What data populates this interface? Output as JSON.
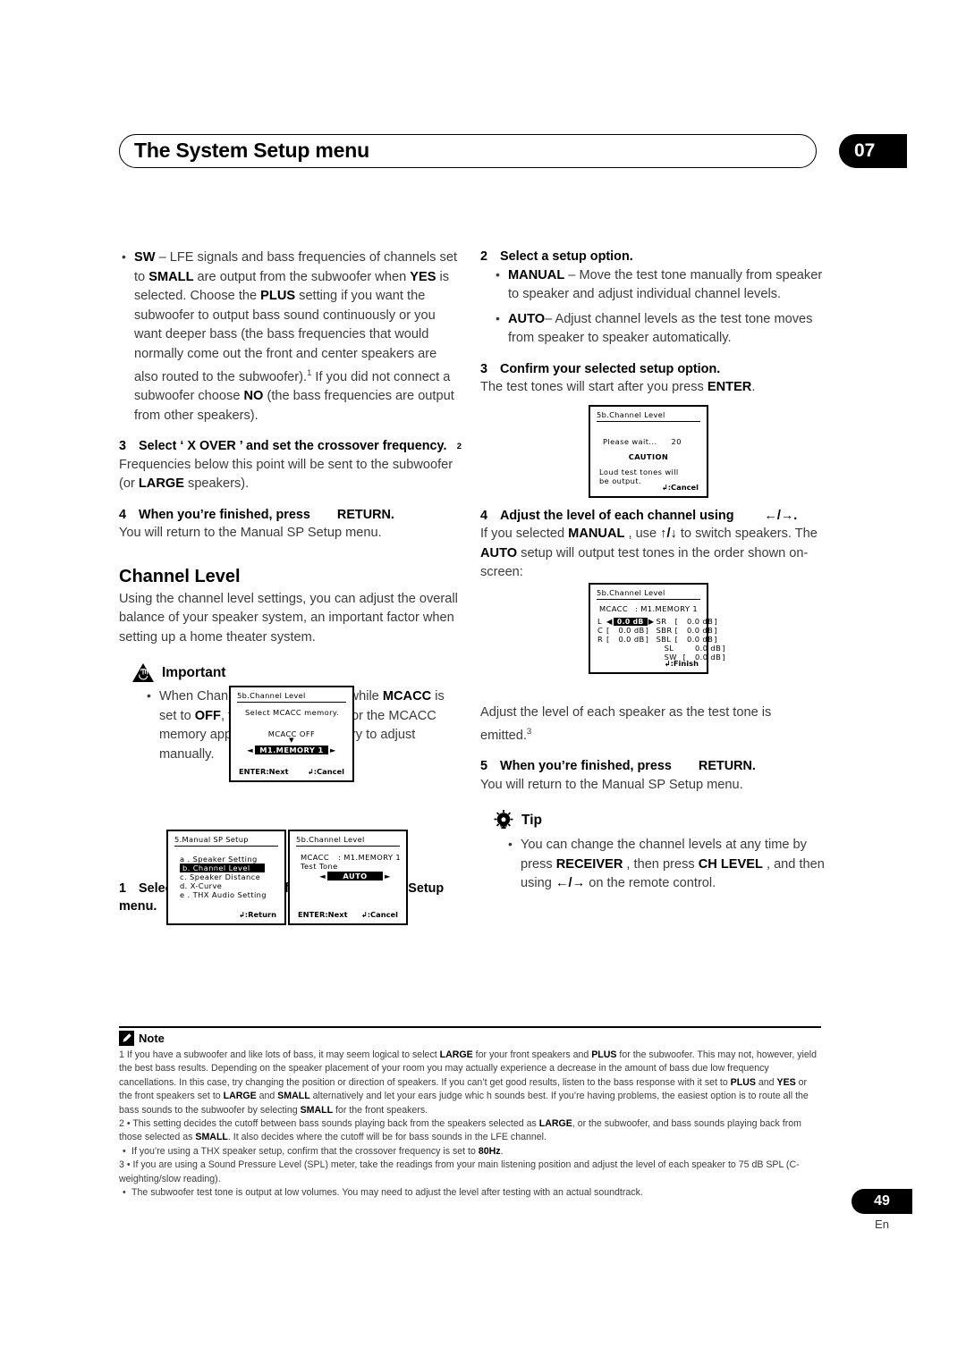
{
  "header": {
    "title": "The System Setup menu",
    "chapter": "07"
  },
  "left_column": {
    "sw_bullet": {
      "label": "SW",
      "text_1": " – LFE signals and bass frequencies of channels set to ",
      "small": "SMALL",
      "text_2": " are output from the subwoofer when ",
      "yes": "YES",
      "text_3": " is selected. Choose the ",
      "plus": "PLUS",
      "text_4": " setting if you want the subwoofer to output bass sound continuously or you want deeper bass (the bass frequencies that would normally come out the front and center speakers are also routed to the subwoofer).",
      "footnote_ref": "1",
      "text_5": " If you did not connect a subwoofer choose ",
      "no": "NO",
      "text_6": " (the bass frequencies are output from other speakers)."
    },
    "step3": {
      "num": "3",
      "title": "Select ‘ X OVER  ’ and set the crossover frequency.",
      "footnote_ref": "2",
      "body_1": "Frequencies below this point will be sent to the subwoofer (or ",
      "large": "LARGE",
      "body_2": " speakers)."
    },
    "step4": {
      "num": "4",
      "title": "When you’re finished, press",
      "title_key": "RETURN",
      "title_end": ".",
      "body": "You will return to the Manual SP Setup menu."
    },
    "section_heading": "Channel Level",
    "section_body": "Using the channel level settings, you can adjust the overall balance of your speaker system, an important factor when setting up a home theater system.",
    "important": {
      "heading": "Important",
      "text_1": "When Channel Level is selected while ",
      "mcacc": "MCACC",
      "text_2": " is set to ",
      "off": "OFF",
      "text_3": ", the selection screen for the MCACC memory appears. Select a memory to adjust manually."
    },
    "step1": {
      "num": "1",
      "title": "Select ‘ Channel Level  ’ from the Manual SP Setup menu."
    }
  },
  "right_column": {
    "step2": {
      "num": "2",
      "title": "Select a setup option.",
      "manual_label": "MANUAL",
      "manual_text": " – Move the test tone manually from speaker to speaker and adjust individual channel levels.",
      "auto_label": "AUTO",
      "auto_text": "– Adjust channel levels as the test tone moves from speaker to speaker automatically."
    },
    "step3": {
      "num": "3",
      "title": "Confirm your selected setup option.",
      "body_1": "The test tones will start after you press ",
      "enter": "ENTER",
      "body_2": "."
    },
    "step4": {
      "num": "4",
      "title": "Adjust the level of each channel using",
      "title_keys": "←/→.",
      "body_1": "If you selected ",
      "manual": "MANUAL",
      "body_2": " , use ",
      "updown": "↑/↓",
      "body_3": " to switch speakers. The ",
      "auto": "AUTO",
      "body_4": " setup will output test tones in the order shown on-screen:"
    },
    "after_levels_1": "Adjust the level of each speaker as the test tone is emitted.",
    "after_levels_ref": "3",
    "step5": {
      "num": "5",
      "title": "When you’re finished, press",
      "title_key": "RETURN",
      "title_end": ".",
      "body": "You will return to the Manual SP Setup menu."
    },
    "tip": {
      "heading": "Tip",
      "text_1": "You can change the channel levels at any time by press ",
      "receiver": "RECEIVER",
      "text_2": " , then press ",
      "chlevel": "CH LEVEL",
      "text_3": " , and then using ",
      "arrows": "←/→",
      "text_4": " on the remote control."
    }
  },
  "osd_screens": {
    "mcacc_memory": {
      "title": "5b.Channel  Level",
      "prompt": "Select  MCACC  memory.",
      "label": "MCACC  OFF",
      "selected": "M1.MEMORY  1",
      "left_arrow": "◄",
      "right_arrow": "►",
      "down_marker": "▼",
      "foot_left": "ENTER:Next",
      "foot_right": ":Cancel"
    },
    "manual_sp_setup": {
      "title": "5.Manual  SP  Setup",
      "items": [
        "a . Speaker  Setting",
        "b. Channel  Level",
        "c. Speaker  Distance",
        "d. X-Curve",
        "e . THX  Audio  Setting"
      ],
      "selected_index": 1,
      "foot_right": ":Return"
    },
    "test_tone": {
      "title": "5b.Channel  Level",
      "row1_label": "MCACC",
      "row1_value": ": M1.MEMORY  1",
      "row2_label": "Test  Tone",
      "selected": "AUTO",
      "left_arrow": "◄",
      "right_arrow": "►",
      "foot_left": "ENTER:Next",
      "foot_right": ":Cancel"
    },
    "please_wait": {
      "title": "5b.Channel  Level",
      "wait_text": "Please  wait...",
      "wait_count": "20",
      "caution": "CAUTION",
      "message_1": "Loud  test  tones  will",
      "message_2": "be  output.",
      "foot_right": ":Cancel"
    },
    "channel_levels": {
      "title": "5b.Channel  Level",
      "mcacc_label": "MCACC",
      "mcacc_value": ": M1.MEMORY  1",
      "left_rows": [
        {
          "ch": "L",
          "value": "0.0 dB",
          "highlighted": true
        },
        {
          "ch": "C",
          "value": "0.0 dB",
          "highlighted": false
        },
        {
          "ch": "R",
          "value": "0.0 dB",
          "highlighted": false
        }
      ],
      "right_rows": [
        {
          "ch": "SR",
          "value": "0.0 dB"
        },
        {
          "ch": "SBR",
          "value": "0.0 dB"
        },
        {
          "ch": "SBL",
          "value": "0.0 dB"
        },
        {
          "ch": "SL",
          "value": "0.0 dB"
        },
        {
          "ch": "SW",
          "value": "0.0 dB"
        }
      ],
      "foot_right": ":Finish"
    }
  },
  "footnotes": {
    "heading": "Note",
    "note1": {
      "num": "1",
      "seg1": "If you have a subwoofer and like lots of bass, it may seem logical to select ",
      "k1": "LARGE",
      "seg2": " for your front speakers and ",
      "k2": "PLUS",
      "seg3": " for the subwoofer. This may not, however, yield the best bass results. Depending on the speaker placement of your room you may actually experience a decrease in the amount of bass due low frequency cancellations. In this case, try changing the position or direction of speakers. If you can’t get good results, listen to the bass response with it set to ",
      "k3": "PLUS",
      "seg4": " and ",
      "k4": "YES",
      "seg5": " or the front speakers set to  ",
      "k5": "LARGE",
      "seg6": "  and ",
      "k6": "SMALL",
      "seg7": " alternatively and let your ears judge whic h sounds best. If you’re having problems, the easiest option is to route all the bass sounds to the subwoofer by selecting ",
      "k7": "SMALL",
      "seg8": " for the front speakers."
    },
    "note2": {
      "num": "2",
      "seg1": "This setting decides the cutoff between bass sounds playing back from the speakers selected as ",
      "k1": "LARGE",
      "seg2": ", or the subwoofer, and bass sounds playing back from those selected as ",
      "k2": "SMALL",
      "seg3": ". It also decides where the cutoff will  be for bass sounds in the LFE channel.",
      "sub1_seg1": "If you’re using a THX speaker setup, confirm that the crossover frequency is set to ",
      "sub1_k1": "80Hz",
      "sub1_seg2": "."
    },
    "note3": {
      "num": "3",
      "seg1": "If you are using a Sound Pressure Level (SPL) meter, take the readings from your main listening position and adjust the level of each speaker to 75 dB SPL (C-weighting/slow reading).",
      "sub1": "The subwoofer test tone is output at low volumes. You may need to adjust the level after testing with an actual soundtrack."
    }
  },
  "page": {
    "number": "49",
    "language": "En"
  }
}
